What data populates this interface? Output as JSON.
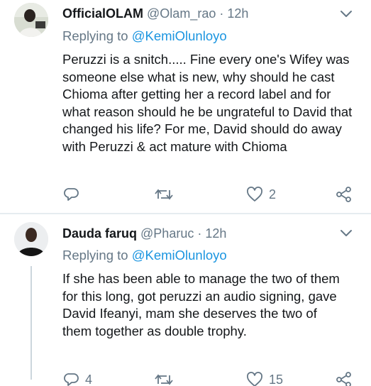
{
  "tweets": [
    {
      "display_name": "OfficialOLAM",
      "handle": "@Olam_rao",
      "time": "12h",
      "replying_prefix": "Replying to",
      "replying_to": "@KemiOlunloyo",
      "body": "Peruzzi is a snitch..... Fine every one's Wifey was someone else what is new, why should he cast Chioma after getting her a record label and for what reason should he be ungrateful to David that changed his life? For me, David should do away with Peruzzi & act mature with Chioma",
      "reply_count": "",
      "retweet_count": "",
      "like_count": "2"
    },
    {
      "display_name": "Dauda faruq",
      "handle": "@Pharuc",
      "time": "12h",
      "replying_prefix": "Replying to",
      "replying_to": "@KemiOlunloyo",
      "body": "If she has been able to manage the two of them for this long, got peruzzi an audio signing, gave David Ifeanyi, mam she deserves the two of them together as double trophy.",
      "reply_count": "4",
      "retweet_count": "",
      "like_count": "15"
    }
  ],
  "icons": {
    "reply": "reply-icon",
    "retweet": "retweet-icon",
    "like": "like-icon",
    "share": "share-icon",
    "more": "chevron-down-icon"
  },
  "colors": {
    "text": "#14171a",
    "muted": "#657786",
    "link": "#1b95e0",
    "divider": "#e6ecf0"
  }
}
